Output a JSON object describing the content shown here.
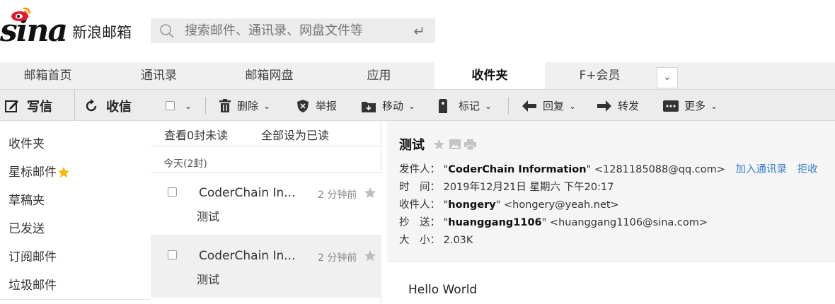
{
  "header": {
    "logo_text": "sina",
    "brand": "新浪邮箱",
    "search_placeholder": "搜索邮件、通讯录、网盘文件等"
  },
  "tabs": [
    {
      "label": "邮箱首页"
    },
    {
      "label": "通讯录"
    },
    {
      "label": "邮箱网盘"
    },
    {
      "label": "应用"
    },
    {
      "label": "收件夹",
      "active": true
    },
    {
      "label": "F+会员"
    }
  ],
  "toolbar": {
    "compose": "写信",
    "receive": "收信",
    "delete": "删除",
    "report": "举报",
    "move": "移动",
    "mark": "标记",
    "reply": "回复",
    "forward": "转发",
    "more": "更多"
  },
  "sidebar": {
    "items": [
      {
        "label": "收件夹"
      },
      {
        "label": "星标邮件"
      },
      {
        "label": "草稿夹"
      },
      {
        "label": "已发送"
      },
      {
        "label": "订阅邮件"
      },
      {
        "label": "垃圾邮件"
      }
    ]
  },
  "maillist": {
    "view_unread": "查看0封未读",
    "mark_all_read": "全部设为已读",
    "group_label": "今天(2封)",
    "rows": [
      {
        "from": "CoderChain In...",
        "time": "2 分钟前",
        "subject": "测试"
      },
      {
        "from": "CoderChain In...",
        "time": "2 分钟前",
        "subject": "测试"
      }
    ]
  },
  "reader": {
    "subject": "测试",
    "sender_label": "发件人：",
    "sender_name": "CoderChain Information",
    "sender_email": "<1281185088@qq.com>",
    "add_contact": "加入通讯录",
    "reject": "拒收",
    "time_label": "时　间：",
    "time_value": "2019年12月21日 星期六 下午20:17",
    "to_label": "收件人：",
    "to_name": "hongery",
    "to_email": "<hongery@yeah.net>",
    "cc_label": "抄　送：",
    "cc_name": "huanggang1106",
    "cc_email": "<huanggang1106@sina.com>",
    "size_label": "大　小：",
    "size_value": "2.03K",
    "body": "Hello World"
  },
  "colors": {
    "accent_link": "#3a7fcf",
    "star_yellow": "#f5b800",
    "logo_red": "#e6162d"
  }
}
